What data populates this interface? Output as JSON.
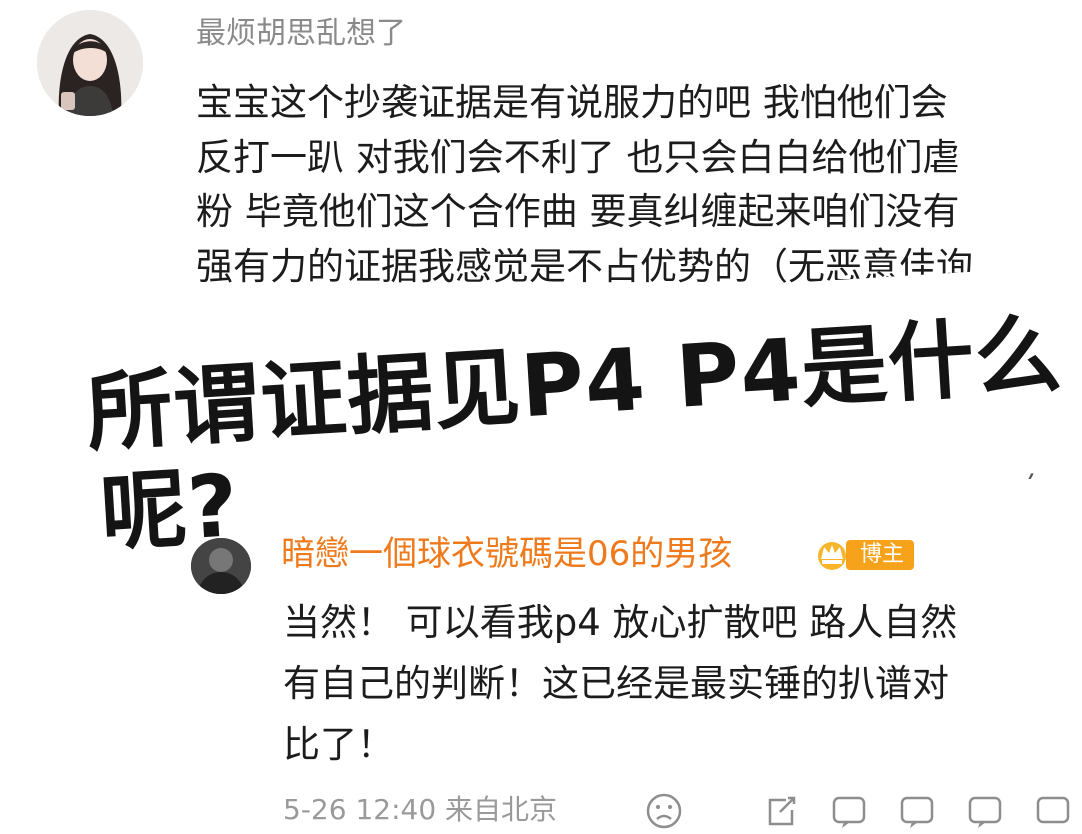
{
  "comment": {
    "username": "最烦胡思乱想了",
    "lines": [
      "宝宝这个抄袭证据是有说服力的吧 我怕他们会",
      "反打一趴 对我们会不利了 也只会白白给他们虐",
      "粉 毕竟他们这个合作曲 要真纠缠起来咱们没有",
      "强有力的证据我感觉是不占优势的（无恶意佳询"
    ]
  },
  "overlay": {
    "line1": "所谓证据见P4 P4是什么",
    "line2": "呢?"
  },
  "reply": {
    "username": "暗戀一個球衣號碼是06的男孩",
    "badge": "博主",
    "lines": [
      "当然！ 可以看我p4 放心扩散吧 路人自然",
      "有自己的判断！这已经是最实锤的扒谱对",
      "比了！"
    ],
    "timestamp": "5-26 12:40 来自北京"
  },
  "footer_icons": [
    "sad-face-icon",
    "share-icon",
    "comment-icon",
    "like-icon"
  ],
  "colors": {
    "reply_name": "#ef7a1c",
    "badge": "#f7a21b",
    "meta": "#9a9a9a"
  }
}
